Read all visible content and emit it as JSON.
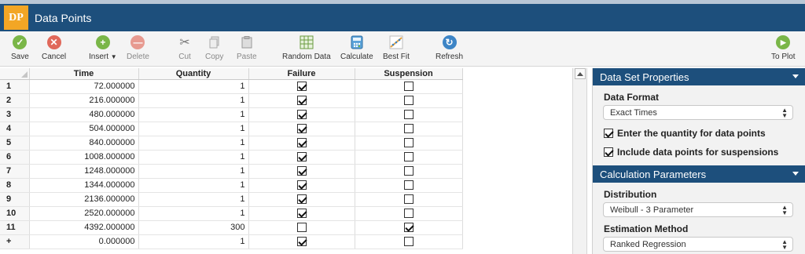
{
  "app": {
    "logo": "DP",
    "title": "Data Points"
  },
  "toolbar": {
    "save": "Save",
    "cancel": "Cancel",
    "insert": "Insert",
    "delete": "Delete",
    "cut": "Cut",
    "copy": "Copy",
    "paste": "Paste",
    "random_data": "Random Data",
    "calculate": "Calculate",
    "best_fit": "Best Fit",
    "refresh": "Refresh",
    "to_plot": "To Plot"
  },
  "grid": {
    "columns": [
      "Time",
      "Quantity",
      "Failure",
      "Suspension"
    ],
    "rows": [
      {
        "num": "1",
        "time": "72.000000",
        "quantity": "1",
        "failure": true,
        "suspension": false
      },
      {
        "num": "2",
        "time": "216.000000",
        "quantity": "1",
        "failure": true,
        "suspension": false
      },
      {
        "num": "3",
        "time": "480.000000",
        "quantity": "1",
        "failure": true,
        "suspension": false
      },
      {
        "num": "4",
        "time": "504.000000",
        "quantity": "1",
        "failure": true,
        "suspension": false
      },
      {
        "num": "5",
        "time": "840.000000",
        "quantity": "1",
        "failure": true,
        "suspension": false
      },
      {
        "num": "6",
        "time": "1008.000000",
        "quantity": "1",
        "failure": true,
        "suspension": false
      },
      {
        "num": "7",
        "time": "1248.000000",
        "quantity": "1",
        "failure": true,
        "suspension": false
      },
      {
        "num": "8",
        "time": "1344.000000",
        "quantity": "1",
        "failure": true,
        "suspension": false
      },
      {
        "num": "9",
        "time": "2136.000000",
        "quantity": "1",
        "failure": true,
        "suspension": false
      },
      {
        "num": "10",
        "time": "2520.000000",
        "quantity": "1",
        "failure": true,
        "suspension": false
      },
      {
        "num": "11",
        "time": "4392.000000",
        "quantity": "300",
        "failure": false,
        "suspension": true
      },
      {
        "num": "+",
        "time": "0.000000",
        "quantity": "1",
        "failure": true,
        "suspension": false
      }
    ]
  },
  "panel": {
    "data_set": {
      "header": "Data Set Properties",
      "format_label": "Data Format",
      "format_value": "Exact Times",
      "opt_quantity": "Enter the quantity for data points",
      "opt_quantity_checked": true,
      "opt_suspensions": "Include data points for suspensions",
      "opt_suspensions_checked": true
    },
    "calc": {
      "header": "Calculation Parameters",
      "distribution_label": "Distribution",
      "distribution_value": "Weibull - 3 Parameter",
      "method_label": "Estimation Method",
      "method_value": "Ranked Regression"
    }
  },
  "colors": {
    "header_blue": "#1d4f7c",
    "logo_orange": "#f3a625",
    "save_green": "#7ab648",
    "cancel_red": "#e0685a",
    "refresh_blue": "#3d85c6"
  }
}
